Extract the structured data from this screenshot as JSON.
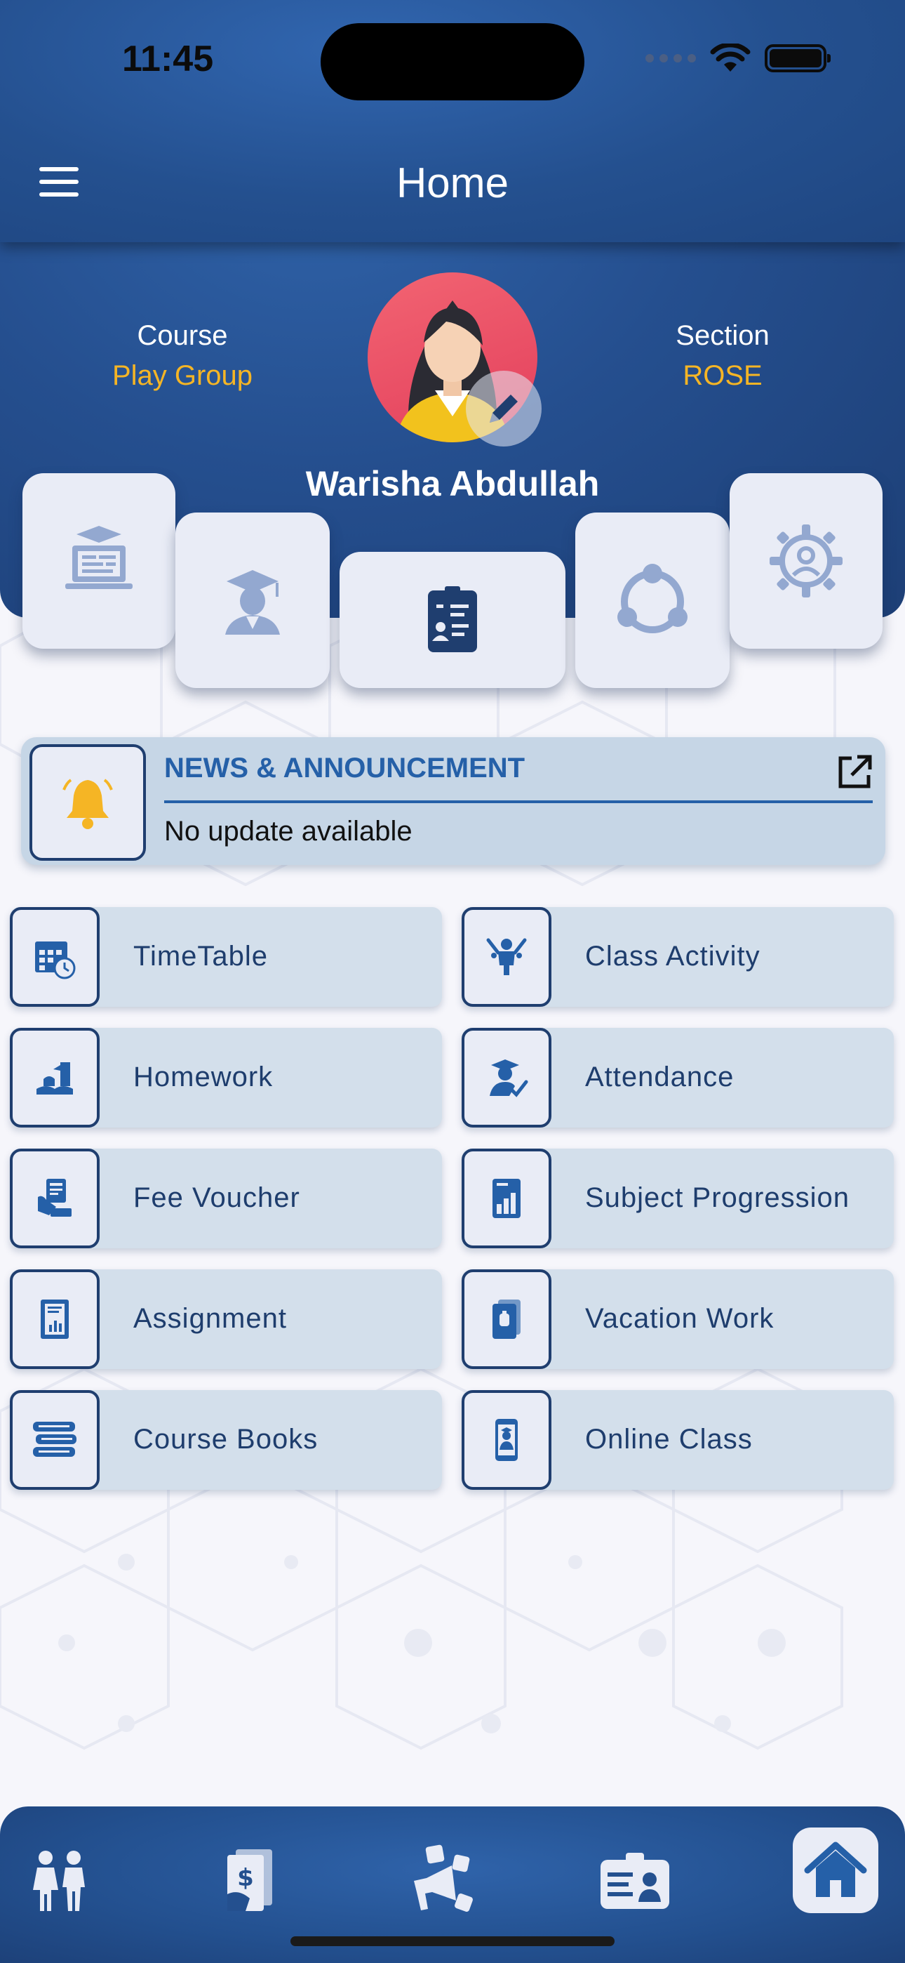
{
  "status_bar": {
    "time": "11:45"
  },
  "appbar": {
    "title": "Home"
  },
  "profile": {
    "course_label": "Course",
    "course_value": "Play Group",
    "section_label": "Section",
    "section_value": "ROSE",
    "student_name": "Warisha Abdullah"
  },
  "quick_actions": [
    {
      "icon": "online-learning-icon"
    },
    {
      "icon": "graduate-icon"
    },
    {
      "icon": "id-card-icon"
    },
    {
      "icon": "community-icon"
    },
    {
      "icon": "settings-user-icon"
    }
  ],
  "news": {
    "title": "NEWS & ANNOUNCEMENT",
    "text": "No update available"
  },
  "menu": [
    {
      "label": "TimeTable",
      "icon": "calendar-clock-icon"
    },
    {
      "label": "Class Activity",
      "icon": "activity-icon"
    },
    {
      "label": "Homework",
      "icon": "homework-icon"
    },
    {
      "label": "Attendance",
      "icon": "attendance-icon"
    },
    {
      "label": "Fee Voucher",
      "icon": "fee-voucher-icon"
    },
    {
      "label": "Subject Progression",
      "icon": "progression-icon"
    },
    {
      "label": "Assignment",
      "icon": "assignment-icon"
    },
    {
      "label": "Vacation Work",
      "icon": "vacation-work-icon"
    },
    {
      "label": "Course Books",
      "icon": "books-icon"
    },
    {
      "label": "Online Class",
      "icon": "online-class-icon"
    }
  ],
  "bottom_nav": [
    {
      "icon": "family-icon"
    },
    {
      "icon": "payment-document-icon"
    },
    {
      "icon": "social-announcement-icon"
    },
    {
      "icon": "profile-card-icon"
    },
    {
      "icon": "home-icon",
      "active": true
    }
  ],
  "colors": {
    "primary": "#25508f",
    "accent": "#f5b525",
    "tile_bg": "#d3dfeb",
    "tile_text": "#1e3d6d",
    "news_title": "#2560a8"
  }
}
